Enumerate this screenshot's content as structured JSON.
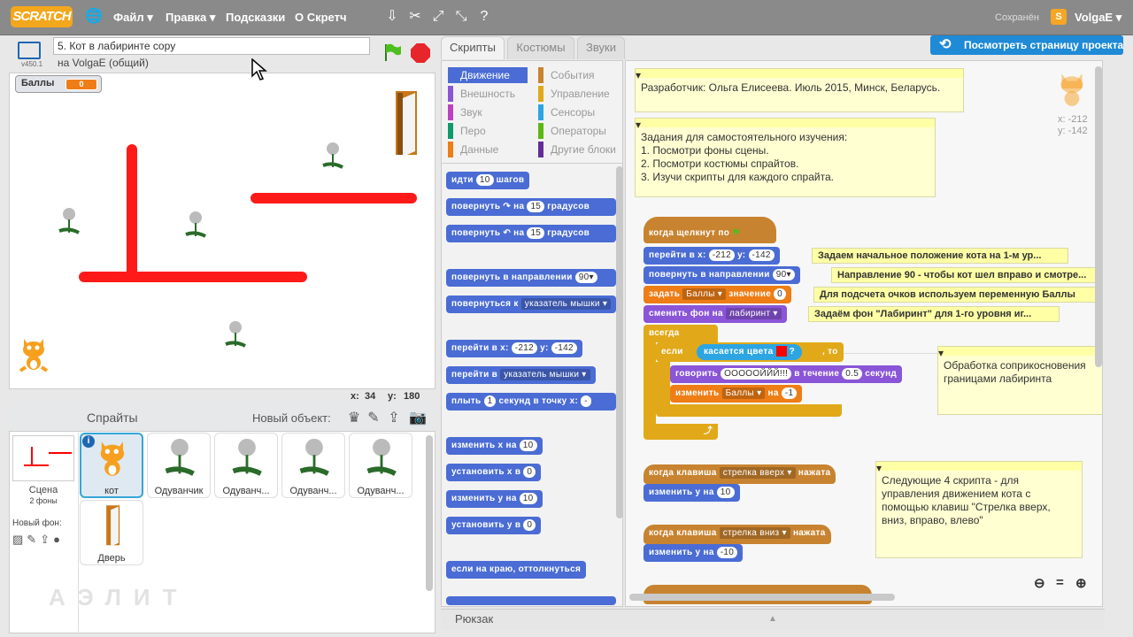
{
  "topbar": {
    "logo": "SCRATCH",
    "menu": [
      "Файл ▾",
      "Правка ▾",
      "Подсказки",
      "О Скретч"
    ],
    "saved": "Сохранён",
    "user": "VolgaE ▾"
  },
  "stage": {
    "project_title": "5. Кот в лабиринте copy",
    "owner": "на VolgaE (общий)",
    "version": "v450.1",
    "variable_label": "Баллы",
    "variable_value": "0",
    "x_label": "x:",
    "x_value": "34",
    "y_label": "y:",
    "y_value": "180"
  },
  "sprites_pane": {
    "title": "Спрайты",
    "new_object": "Новый объект:",
    "scene_label": "Сцена",
    "scene_sub": "2 фоны",
    "new_backdrop": "Новый фон:",
    "sprites": [
      "кот",
      "Одуванчик",
      "Одуванч...",
      "Одуванч...",
      "Одуванч...",
      "Дверь"
    ]
  },
  "tabs": [
    "Скрипты",
    "Костюмы",
    "Звуки"
  ],
  "view_project_button": "Посмотреть страницу проекта",
  "categories": [
    {
      "label": "Движение",
      "color": "#4a6cd4"
    },
    {
      "label": "События",
      "color": "#c88330"
    },
    {
      "label": "Внешность",
      "color": "#8a55d7"
    },
    {
      "label": "Управление",
      "color": "#e1a91a"
    },
    {
      "label": "Звук",
      "color": "#bb42c3"
    },
    {
      "label": "Сенсоры",
      "color": "#2ca5e2"
    },
    {
      "label": "Перо",
      "color": "#0e9a6c"
    },
    {
      "label": "Операторы",
      "color": "#5cb712"
    },
    {
      "label": "Данные",
      "color": "#ee7d16"
    },
    {
      "label": "Другие блоки",
      "color": "#632d99"
    }
  ],
  "palette": {
    "b1": {
      "a": "идти",
      "v": "10",
      "b": "шагов"
    },
    "b2": {
      "a": "повернуть ↷ на",
      "v": "15",
      "b": "градусов"
    },
    "b3": {
      "a": "повернуть ↶ на",
      "v": "15",
      "b": "градусов"
    },
    "b4": {
      "a": "повернуть в направлении",
      "v": "90▾"
    },
    "b5": {
      "a": "повернуться к",
      "v": "указатель мышки ▾"
    },
    "b6": {
      "a": "перейти в x:",
      "v": "-212",
      "b": "y:",
      "w": "-142"
    },
    "b7": {
      "a": "перейти в",
      "v": "указатель мышки ▾"
    },
    "b8": {
      "a": "плыть",
      "v": "1",
      "b": "секунд в точку x:",
      "w": "-"
    },
    "b9": {
      "a": "изменить х на",
      "v": "10"
    },
    "b10": {
      "a": "установить х в",
      "v": "0"
    },
    "b11": {
      "a": "изменить у на",
      "v": "10"
    },
    "b12": {
      "a": "установить у в",
      "v": "0"
    },
    "b13": {
      "a": "если на краю, оттолкнуться"
    }
  },
  "scripts": {
    "comment1": "Разработчик: Ольга Елисеева. Июль 2015, Минск, Беларусь.",
    "comment2": {
      "l1": "Задания для самостоятельного изучения:",
      "l2": "1. Посмотри фоны сцены.",
      "l3": "2. Посмотри костюмы спрайтов.",
      "l4": "3. Изучи скрипты для каждого спрайта."
    },
    "hat_flag": "когда щелкнут по",
    "goto": {
      "a": "перейти в х:",
      "x": "-212",
      "b": "у:",
      "y": "-142"
    },
    "note_goto": "Задаем начальное положение кота на 1-м ур...",
    "point": {
      "a": "повернуть в направлении",
      "v": "90▾"
    },
    "note_point": "Направление 90 - чтобы кот шел вправо и смотре...",
    "setvar": {
      "a": "задать",
      "v": "Баллы ▾",
      "b": "значение",
      "w": "0"
    },
    "note_setvar": "Для подсчета очков используем переменную Баллы",
    "backdrop": {
      "a": "сменить фон на",
      "v": "лабиринт ▾"
    },
    "note_backdrop": "Задаём фон \"Лабиринт\" для 1-го уровня иг...",
    "forever": "всегда",
    "if_a": "если",
    "touching": "касается цвета",
    "qmark": "?",
    "if_then": ", то",
    "say": {
      "a": "говорить",
      "v": "ОООООЙЙЙ!!!",
      "b": "в течение",
      "w": "0.5",
      "c": "секунд"
    },
    "change": {
      "a": "изменить",
      "v": "Баллы ▾",
      "b": "на",
      "w": "-1"
    },
    "comment3": {
      "l1": "Обработка соприкосновения",
      "l2": "границами лабиринта"
    },
    "key_up": {
      "a": "когда клавиша",
      "v": "стрелка вверх ▾",
      "b": "нажата"
    },
    "chg_y1": {
      "a": "изменить у на",
      "v": "10"
    },
    "key_down": {
      "a": "когда клавиша",
      "v": "стрелка вниз ▾",
      "b": "нажата"
    },
    "chg_y2": {
      "a": "изменить у на",
      "v": "-10"
    },
    "comment4": {
      "l1": "Следующие 4 скрипта - для",
      "l2": "управления движением кота с",
      "l3": "помощью клавиш \"Стрелка вверх,",
      "l4": "вниз, вправо, влево\""
    },
    "sprite_x": "x: -212",
    "sprite_y": "y: -142"
  },
  "backpack": "Рюкзак",
  "zoom": [
    "⊖",
    "=",
    "⊕"
  ],
  "watermark": "АЭЛИТ"
}
